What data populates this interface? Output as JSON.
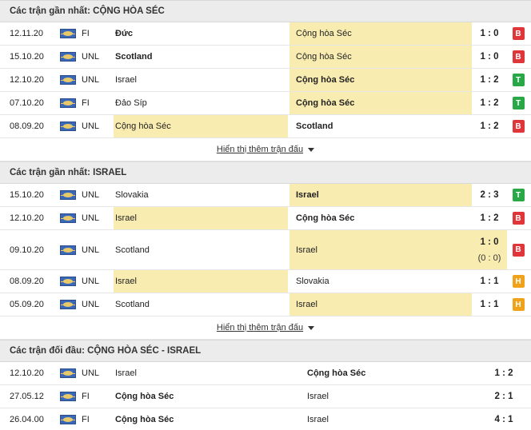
{
  "colors": {
    "win": "#29a847",
    "loss": "#e0363a",
    "draw": "#f0a21a",
    "highlight": "#f9ecb1"
  },
  "sections": [
    {
      "title": "Các trận gần nhất: CỘNG HÒA SÉC",
      "more_label": "Hiển thị thêm trận đấu",
      "rows": [
        {
          "date": "12.11.20",
          "comp": "FI",
          "home": "Đức",
          "away": "Cộng hòa Séc",
          "score": "1 : 0",
          "result": "B",
          "bold": "home",
          "hl": "away"
        },
        {
          "date": "15.10.20",
          "comp": "UNL",
          "home": "Scotland",
          "away": "Cộng hòa Séc",
          "score": "1 : 0",
          "result": "B",
          "bold": "home",
          "hl": "away"
        },
        {
          "date": "12.10.20",
          "comp": "UNL",
          "home": "Israel",
          "away": "Cộng hòa Séc",
          "score": "1 : 2",
          "result": "T",
          "bold": "away",
          "hl": "away"
        },
        {
          "date": "07.10.20",
          "comp": "FI",
          "home": "Đảo Síp",
          "away": "Cộng hòa Séc",
          "score": "1 : 2",
          "result": "T",
          "bold": "away",
          "hl": "away"
        },
        {
          "date": "08.09.20",
          "comp": "UNL",
          "home": "Cộng hòa Séc",
          "away": "Scotland",
          "score": "1 : 2",
          "result": "B",
          "bold": "away",
          "hl": "home"
        }
      ]
    },
    {
      "title": "Các trận gần nhất: ISRAEL",
      "more_label": "Hiển thị thêm trận đấu",
      "rows": [
        {
          "date": "15.10.20",
          "comp": "UNL",
          "home": "Slovakia",
          "away": "Israel",
          "score": "2 : 3",
          "result": "T",
          "bold": "away",
          "hl": "away"
        },
        {
          "date": "12.10.20",
          "comp": "UNL",
          "home": "Israel",
          "away": "Cộng hòa Séc",
          "score": "1 : 2",
          "result": "B",
          "bold": "away",
          "hl": "home"
        },
        {
          "date": "09.10.20",
          "comp": "UNL",
          "home": "Scotland",
          "away": "Israel",
          "score": "1 : 0",
          "ht": "(0 : 0)",
          "result": "B",
          "bold": "",
          "hl": "away",
          "tall": true
        },
        {
          "date": "08.09.20",
          "comp": "UNL",
          "home": "Israel",
          "away": "Slovakia",
          "score": "1 : 1",
          "result": "H",
          "bold": "",
          "hl": "home"
        },
        {
          "date": "05.09.20",
          "comp": "UNL",
          "home": "Scotland",
          "away": "Israel",
          "score": "1 : 1",
          "result": "H",
          "bold": "",
          "hl": "away"
        }
      ]
    }
  ],
  "h2h": {
    "title": "Các trận đối đầu: CỘNG HÒA SÉC - ISRAEL",
    "rows": [
      {
        "date": "12.10.20",
        "comp": "UNL",
        "home": "Israel",
        "away": "Cộng hòa Séc",
        "score": "1 : 2",
        "bold": "away"
      },
      {
        "date": "27.05.12",
        "comp": "FI",
        "home": "Cộng hòa Séc",
        "away": "Israel",
        "score": "2 : 1",
        "bold": "home"
      },
      {
        "date": "26.04.00",
        "comp": "FI",
        "home": "Cộng hòa Séc",
        "away": "Israel",
        "score": "4 : 1",
        "bold": "home"
      }
    ]
  }
}
